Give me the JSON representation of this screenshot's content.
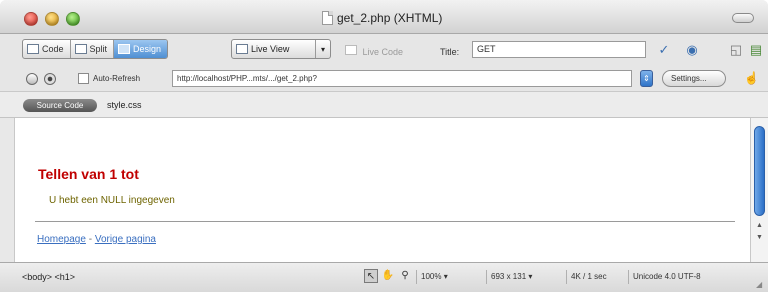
{
  "window": {
    "title": "get_2.php (XHTML)"
  },
  "toolbar": {
    "code_label": "Code",
    "split_label": "Split",
    "design_label": "Design",
    "live_view_label": "Live View",
    "live_code_label": "Live Code",
    "title_label": "Title:",
    "title_value": "GET",
    "live_view_arrow": "▾",
    "right_icons": [
      "validate-icon",
      "browser-preview-icon",
      "refresh-icon",
      "view-options-icon"
    ]
  },
  "addressbar": {
    "auto_refresh_label": "Auto-Refresh",
    "auto_refresh_checked": false,
    "url": "http://localhost/PHP...mts/.../get_2.php?",
    "settings_label": "Settings..."
  },
  "related_files": {
    "source_code_label": "Source Code",
    "files": [
      "style.css"
    ]
  },
  "document": {
    "heading": "Tellen van 1 tot",
    "message": "U hebt een NULL ingegeven",
    "links": [
      {
        "label": "Homepage"
      },
      {
        "label": "Vorige pagina"
      }
    ],
    "link_separator": "-"
  },
  "statusbar": {
    "tag_selector": "<body> <h1>",
    "zoom": "100%",
    "window_size": "693 x 131",
    "download": "4K / 1 sec",
    "encoding": "Unicode 4.0 UTF-8"
  },
  "colors": {
    "heading": "#c00000",
    "message": "#6e6400",
    "link": "#3a6fc0",
    "active_button": "#4f8fd3"
  }
}
